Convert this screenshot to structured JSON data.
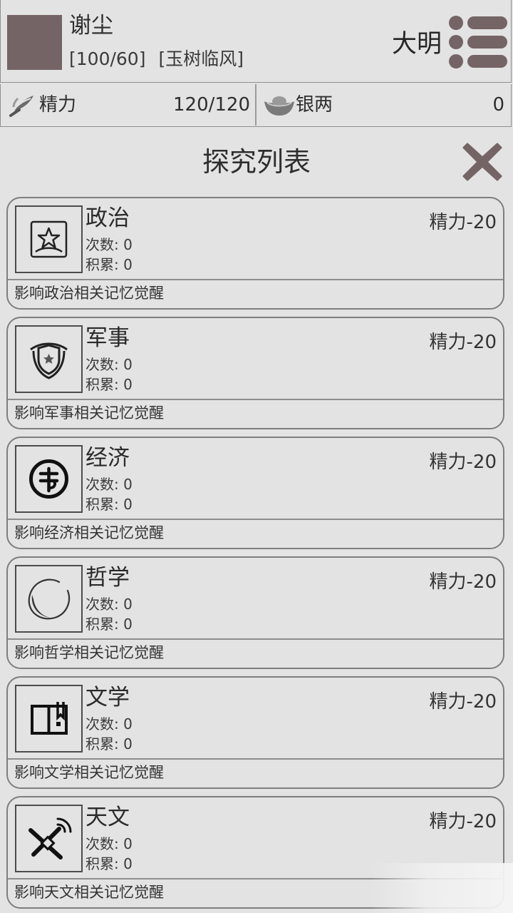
{
  "header": {
    "name": "谢尘",
    "stat_a": "[100/60]",
    "stat_b": "[玉树临风]",
    "dynasty": "大明",
    "avatar_color": "#756465",
    "menu_icon": "menu-icon"
  },
  "resources": {
    "energy": {
      "icon": "feather-brush-icon",
      "label": "精力",
      "value": "120/120"
    },
    "silver": {
      "icon": "silver-ingot-icon",
      "label": "银两",
      "value": "0"
    }
  },
  "panel": {
    "title": "探究列表",
    "close_icon": "close-icon"
  },
  "research_items": [
    {
      "icon": "star-seal-icon",
      "name": "政治",
      "count": "次数: 0",
      "accum": "积累: 0",
      "cost": "精力-20",
      "desc": "影响政治相关记忆觉醒"
    },
    {
      "icon": "shield-emblem-icon",
      "name": "军事",
      "count": "次数: 0",
      "accum": "积累: 0",
      "cost": "精力-20",
      "desc": "影响军事相关记忆觉醒"
    },
    {
      "icon": "coin-icon",
      "name": "经济",
      "count": "次数: 0",
      "accum": "积累: 0",
      "cost": "精力-20",
      "desc": "影响经济相关记忆觉醒"
    },
    {
      "icon": "enso-circle-icon",
      "name": "哲学",
      "count": "次数: 0",
      "accum": "积累: 0",
      "cost": "精力-20",
      "desc": "影响哲学相关记忆觉醒"
    },
    {
      "icon": "book-bookmark-icon",
      "name": "文学",
      "count": "次数: 0",
      "accum": "积累: 0",
      "cost": "精力-20",
      "desc": "影响文学相关记忆觉醒"
    },
    {
      "icon": "satellite-icon",
      "name": "天文",
      "count": "次数: 0",
      "accum": "积累: 0",
      "cost": "精力-20",
      "desc": "影响天文相关记忆觉醒"
    }
  ]
}
